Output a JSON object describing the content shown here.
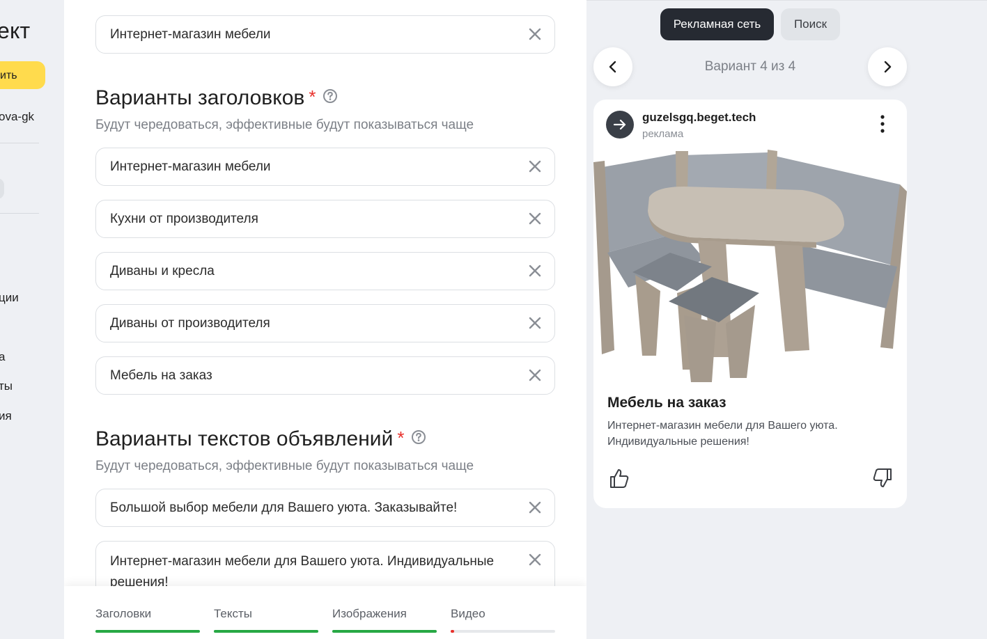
{
  "sidebar": {
    "title": "ект",
    "button_label": "ить",
    "user": "ova-gk",
    "items": [
      "ции",
      "а",
      "ты",
      "ия"
    ]
  },
  "form": {
    "top_field": "Интернет-магазин мебели",
    "headlines": {
      "title": "Варианты заголовков",
      "required_mark": "*",
      "subtitle": "Будут чередоваться, эффективные будут показываться чаще",
      "items": [
        "Интернет-магазин мебели",
        "Кухни от производителя",
        "Диваны и кресла",
        "Диваны от производителя",
        "Мебель на заказ"
      ]
    },
    "texts": {
      "title": "Варианты текстов объявлений",
      "required_mark": "*",
      "subtitle": "Будут чередоваться, эффективные будут показываться чаще",
      "items": [
        "Большой выбор мебели для Вашего уюта. Заказывайте!",
        "Интернет-магазин мебели для Вашего уюта. Индивидуальные решения!"
      ]
    },
    "tabs": [
      {
        "label": "Заголовки",
        "progress": 1.0,
        "status": "complete"
      },
      {
        "label": "Тексты",
        "progress": 1.0,
        "status": "complete"
      },
      {
        "label": "Изображения",
        "progress": 1.0,
        "status": "complete"
      },
      {
        "label": "Видео",
        "progress": 0.03,
        "status": "empty"
      }
    ]
  },
  "preview": {
    "toggle_active": "Рекламная сеть",
    "toggle_other": "Поиск",
    "variant_label": "Вариант 4 из 4",
    "card": {
      "domain": "guzelsgq.beget.tech",
      "ad_label": "реклама",
      "headline": "Мебель на заказ",
      "text": "Интернет-магазин мебели для Вашего уюта. Индивидуальные решения!"
    }
  },
  "colors": {
    "accent_yellow": "#ffdb4d",
    "progress_green": "#27a844",
    "required_red": "#e8302b",
    "dark_toggle": "#262a32"
  }
}
